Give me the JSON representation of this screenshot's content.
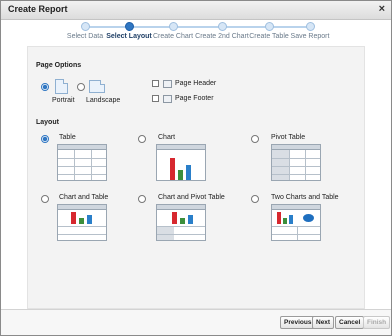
{
  "dialog": {
    "title": "Create Report",
    "close_glyph": "×"
  },
  "wizard": {
    "steps": [
      {
        "label": "Select Data"
      },
      {
        "label": "Select Layout"
      },
      {
        "label": "Create Chart"
      },
      {
        "label": "Create 2nd Chart"
      },
      {
        "label": "Create Table"
      },
      {
        "label": "Save Report"
      }
    ],
    "active_step": 1
  },
  "page_options": {
    "heading": "Page Options",
    "orientation": {
      "portrait_label": "Portrait",
      "landscape_label": "Landscape",
      "selected": "Portrait"
    },
    "page_header_label": "Page Header",
    "page_footer_label": "Page Footer",
    "page_header_checked": false,
    "page_footer_checked": false
  },
  "layout": {
    "heading": "Layout",
    "options": [
      {
        "label": "Table"
      },
      {
        "label": "Chart"
      },
      {
        "label": "Pivot Table"
      },
      {
        "label": "Chart and Table"
      },
      {
        "label": "Chart and Pivot Table"
      },
      {
        "label": "Two Charts and Table"
      }
    ],
    "selected": "Table"
  },
  "footer": {
    "previous_label": "Previous",
    "next_label": "Next",
    "cancel_label": "Cancel",
    "finish_label": "Finish",
    "finish_enabled": false
  },
  "colors": {
    "accent": "#2f76c2",
    "bar_red": "#d7282f",
    "bar_green": "#3c8f3c",
    "bar_blue": "#2a7fc9"
  }
}
